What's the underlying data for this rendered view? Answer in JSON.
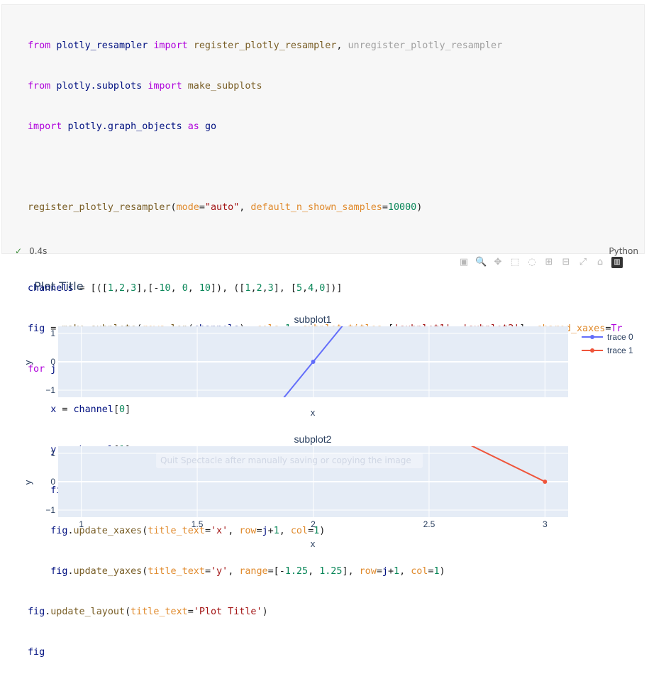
{
  "code": {
    "lines": [
      "from plotly_resampler import register_plotly_resampler, unregister_plotly_resampler",
      "from plotly.subplots import make_subplots",
      "import plotly.graph_objects as go",
      "",
      "register_plotly_resampler(mode=\"auto\", default_n_shown_samples=10000)",
      "",
      "channels = [([1,2,3],[-10, 0, 10]), ([1,2,3], [5,4,0])]",
      "fig = make_subplots(rows=len(channels), cols=1, subplot_titles=['subplot1', 'subplot2'], shared_xaxes=Tr",
      "for j, channel in enumerate(channels):",
      "    x = channel[0]",
      "    y = channel[1]",
      "    fig.add_trace(go.Scattergl(x=x, y=y), row=j+1, col=1)",
      "    fig.update_xaxes(title_text='x', row=j+1, col=1)",
      "    fig.update_yaxes(title_text='y', range=[-1.25, 1.25], row=j+1, col=1)",
      "fig.update_layout(title_text='Plot Title')",
      "fig"
    ]
  },
  "status": {
    "check": "✓",
    "time": "0.4s",
    "language": "Python"
  },
  "toolbar": [
    "camera-icon",
    "zoom-icon",
    "pan-icon",
    "box-select-icon",
    "lasso-icon",
    "zoom-in-icon",
    "zoom-out-icon",
    "autoscale-icon",
    "reset-axes-icon",
    "plotly-logo-icon"
  ],
  "overlay_text": "Quit Spectacle after manually saving or copying the image",
  "chart_data": {
    "type": "line",
    "title": "Plot Title",
    "legend_placement": "top-right",
    "subplots": [
      {
        "title": "subplot1",
        "xlabel": "x",
        "ylabel": "y",
        "ylim": [
          -1.25,
          1.25
        ],
        "xlim": [
          0.9,
          3.1
        ],
        "yticks": [
          "1",
          "0",
          "−1"
        ],
        "series": [
          {
            "name": "trace 0",
            "color": "#636efa",
            "x": [
              1,
              2,
              3
            ],
            "y": [
              -10,
              0,
              10
            ]
          }
        ]
      },
      {
        "title": "subplot2",
        "xlabel": "x",
        "ylabel": "y",
        "ylim": [
          -1.25,
          1.25
        ],
        "xlim": [
          0.9,
          3.1
        ],
        "yticks": [
          "1",
          "0",
          "−1"
        ],
        "xticks": [
          "1",
          "1.5",
          "2",
          "2.5",
          "3"
        ],
        "series": [
          {
            "name": "trace 1",
            "color": "#ef553b",
            "x": [
              1,
              2,
              3
            ],
            "y": [
              5,
              4,
              0
            ]
          }
        ]
      }
    ]
  }
}
